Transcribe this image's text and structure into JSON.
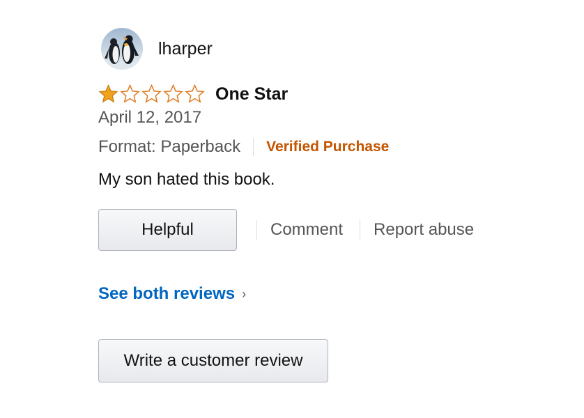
{
  "reviewer": {
    "username": "lharper",
    "avatar_icon": "penguin-avatar-icon"
  },
  "rating": {
    "stars": 1,
    "max_stars": 5,
    "filled_color": "#f0a31c",
    "empty_color": "#de7921"
  },
  "review": {
    "title": "One Star",
    "date": "April 12, 2017",
    "format": "Format: Paperback",
    "verified_label": "Verified Purchase",
    "body": "My son hated this book."
  },
  "actions": {
    "helpful_label": "Helpful",
    "comment_label": "Comment",
    "report_label": "Report abuse"
  },
  "see_all": {
    "label": "See both reviews",
    "chevron": "›"
  },
  "write_review": {
    "label": "Write a customer review"
  },
  "colors": {
    "link_blue": "#0066c0",
    "verified_orange": "#c45500",
    "muted_text": "#555555"
  }
}
